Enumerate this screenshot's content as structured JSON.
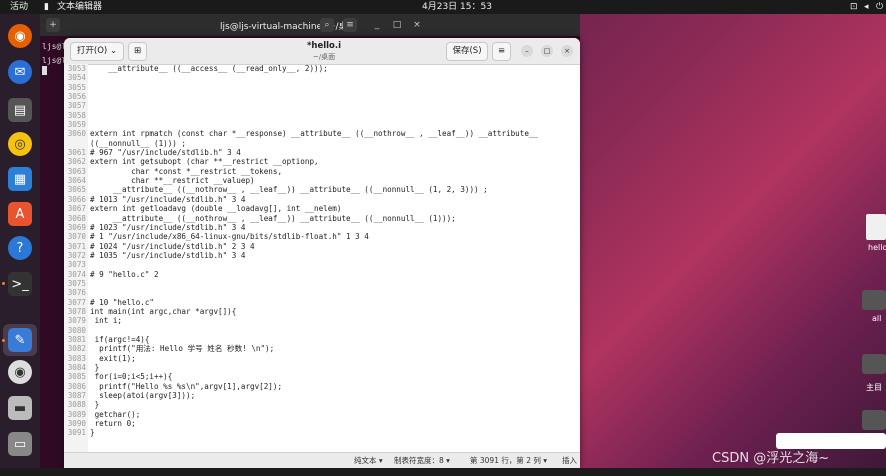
{
  "topbar": {
    "activities": "活动",
    "app": "文本编辑器",
    "clock": "4月23日 15：53"
  },
  "terminal": {
    "title": "ljs@ljs-virtual-machine: ~/桌面",
    "prompt": "ljs@l",
    "prompt2": "ljs@l"
  },
  "editor": {
    "open_label": "打开(O)",
    "title": "*hello.i",
    "subtitle": "~/桌面",
    "save_label": "保存(S)"
  },
  "code": [
    {
      "n": "3053",
      "t": "    __attribute__ ((__access__ (__read_only__, 2)));"
    },
    {
      "n": "3054",
      "t": ""
    },
    {
      "n": "3055",
      "t": ""
    },
    {
      "n": "3056",
      "t": ""
    },
    {
      "n": "3057",
      "t": ""
    },
    {
      "n": "3058",
      "t": ""
    },
    {
      "n": "3059",
      "t": ""
    },
    {
      "n": "3060",
      "t": "extern int rpmatch (const char *__response) __attribute__ ((__nothrow__ , __leaf__)) __attribute__"
    },
    {
      "n": "",
      "t": "((__nonnull__ (1))) ;"
    },
    {
      "n": "3061",
      "t": "# 967 \"/usr/include/stdlib.h\" 3 4"
    },
    {
      "n": "3062",
      "t": "extern int getsubopt (char **__restrict __optionp,"
    },
    {
      "n": "3063",
      "t": "         char *const *__restrict __tokens,"
    },
    {
      "n": "3064",
      "t": "         char **__restrict __valuep)"
    },
    {
      "n": "3065",
      "t": "     __attribute__ ((__nothrow__ , __leaf__)) __attribute__ ((__nonnull__ (1, 2, 3))) ;"
    },
    {
      "n": "3066",
      "t": "# 1013 \"/usr/include/stdlib.h\" 3 4"
    },
    {
      "n": "3067",
      "t": "extern int getloadavg (double __loadavg[], int __nelem)"
    },
    {
      "n": "3068",
      "t": "     __attribute__ ((__nothrow__ , __leaf__)) __attribute__ ((__nonnull__ (1)));"
    },
    {
      "n": "3069",
      "t": "# 1023 \"/usr/include/stdlib.h\" 3 4"
    },
    {
      "n": "3070",
      "t": "# 1 \"/usr/include/x86_64-linux-gnu/bits/stdlib-float.h\" 1 3 4"
    },
    {
      "n": "3071",
      "t": "# 1024 \"/usr/include/stdlib.h\" 2 3 4"
    },
    {
      "n": "3072",
      "t": "# 1035 \"/usr/include/stdlib.h\" 3 4"
    },
    {
      "n": "3073",
      "t": ""
    },
    {
      "n": "3074",
      "t": "# 9 \"hello.c\" 2"
    },
    {
      "n": "3075",
      "t": ""
    },
    {
      "n": "3076",
      "t": ""
    },
    {
      "n": "3077",
      "t": "# 10 \"hello.c\""
    },
    {
      "n": "3078",
      "t": "int main(int argc,char *argv[]){"
    },
    {
      "n": "3079",
      "t": " int i;"
    },
    {
      "n": "3080",
      "t": ""
    },
    {
      "n": "3081",
      "t": " if(argc!=4){"
    },
    {
      "n": "3082",
      "t": "  printf(\"用法: Hello 学号 姓名 秒数! \\n\");"
    },
    {
      "n": "3083",
      "t": "  exit(1);"
    },
    {
      "n": "3084",
      "t": " }"
    },
    {
      "n": "3085",
      "t": " for(i=0;i<5;i++){"
    },
    {
      "n": "3086",
      "t": "  printf(\"Hello %s %s\\n\",argv[1],argv[2]);"
    },
    {
      "n": "3087",
      "t": "  sleep(atoi(argv[3]));"
    },
    {
      "n": "3088",
      "t": " }"
    },
    {
      "n": "3089",
      "t": " getchar();"
    },
    {
      "n": "3090",
      "t": " return 0;"
    },
    {
      "n": "3091",
      "t": "}"
    }
  ],
  "status": {
    "lang": "纯文本 ▾",
    "tab": "制表符宽度：8 ▾",
    "pos": "第 3091 行，第 2 列 ▾",
    "mode": "插入"
  },
  "desktop": {
    "file1": "hello",
    "label_all": "all",
    "label_home": "主目"
  },
  "watermark": "CSDN @浮光之海~"
}
